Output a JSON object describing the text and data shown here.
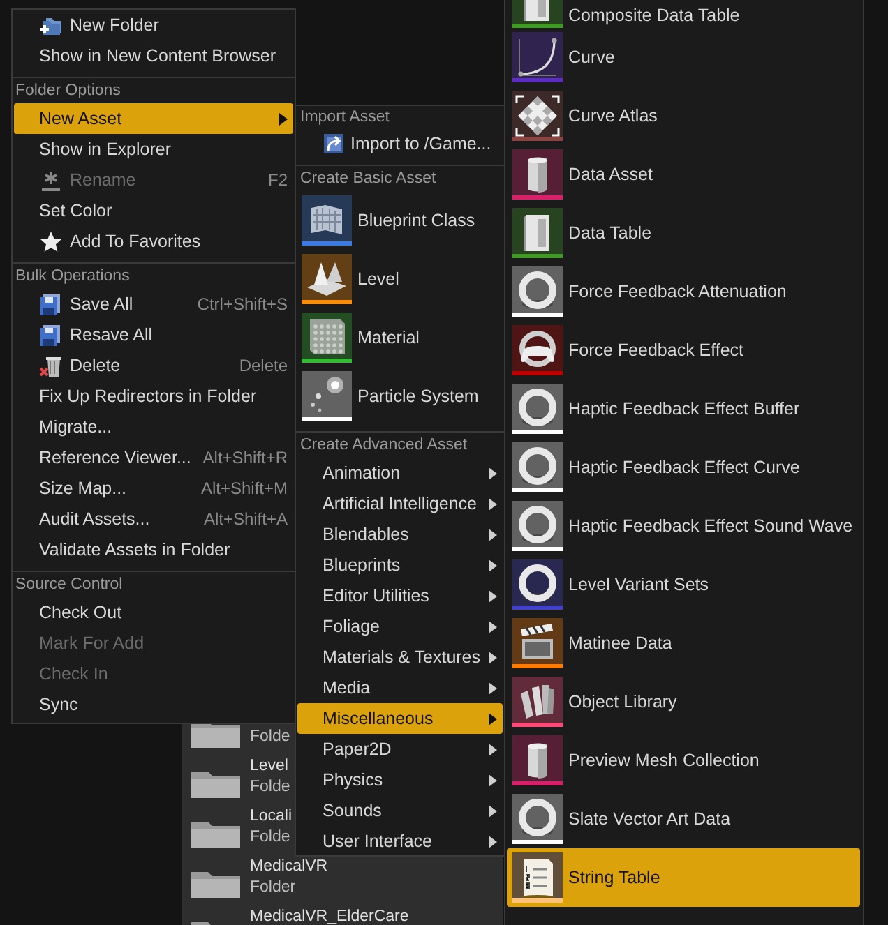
{
  "content_browser": {
    "folders": [
      {
        "type": "Folde"
      },
      {
        "name": "Level",
        "type": "Folde"
      },
      {
        "name": "Locali",
        "type": "Folde"
      },
      {
        "name": "MedicalVR",
        "type": "Folder"
      },
      {
        "name": "MedicalVR_ElderCare"
      }
    ]
  },
  "folder_menu": {
    "sections": [
      {
        "items": [
          {
            "label": "New Folder",
            "kind": "new-folder",
            "selected": false,
            "disabled": false,
            "submenu": false
          },
          {
            "label": "Show in New Content Browser",
            "selected": false,
            "disabled": false,
            "submenu": false
          }
        ]
      },
      {
        "header": "Folder Options",
        "items": [
          {
            "label": "New Asset",
            "selected": true,
            "disabled": false,
            "submenu": true
          },
          {
            "label": "Show in Explorer",
            "selected": false,
            "disabled": false,
            "submenu": false
          },
          {
            "label": "Rename",
            "kind": "rename",
            "shortcut": "F2",
            "selected": false,
            "disabled": true,
            "submenu": false
          },
          {
            "label": "Set Color",
            "selected": false,
            "disabled": false,
            "submenu": false
          },
          {
            "label": "Add To Favorites",
            "kind": "star",
            "selected": false,
            "disabled": false,
            "submenu": false
          }
        ]
      },
      {
        "header": "Bulk Operations",
        "items": [
          {
            "label": "Save All",
            "kind": "save",
            "shortcut": "Ctrl+Shift+S",
            "selected": false,
            "disabled": false,
            "submenu": false
          },
          {
            "label": "Resave All",
            "kind": "save",
            "selected": false,
            "disabled": false,
            "submenu": false
          },
          {
            "label": "Delete",
            "kind": "delete",
            "shortcut": "Delete",
            "selected": false,
            "disabled": false,
            "submenu": false
          },
          {
            "label": "Fix Up Redirectors in Folder",
            "selected": false,
            "disabled": false,
            "submenu": false
          },
          {
            "label": "Migrate...",
            "selected": false,
            "disabled": false,
            "submenu": false
          },
          {
            "label": "Reference Viewer...",
            "shortcut": "Alt+Shift+R",
            "selected": false,
            "disabled": false,
            "submenu": false
          },
          {
            "label": "Size Map...",
            "shortcut": "Alt+Shift+M",
            "selected": false,
            "disabled": false,
            "submenu": false
          },
          {
            "label": "Audit Assets...",
            "shortcut": "Alt+Shift+A",
            "selected": false,
            "disabled": false,
            "submenu": false
          },
          {
            "label": "Validate Assets in Folder",
            "selected": false,
            "disabled": false,
            "submenu": false
          }
        ]
      },
      {
        "header": "Source Control",
        "items": [
          {
            "label": "Check Out",
            "selected": false,
            "disabled": false,
            "submenu": false
          },
          {
            "label": "Mark For Add",
            "selected": false,
            "disabled": true,
            "submenu": false
          },
          {
            "label": "Check In",
            "selected": false,
            "disabled": true,
            "submenu": false
          },
          {
            "label": "Sync",
            "selected": false,
            "disabled": false,
            "submenu": false
          }
        ]
      }
    ]
  },
  "new_asset_menu": {
    "import_header": "Import Asset",
    "import_item": {
      "label": "Import to /Game..."
    },
    "basic_header": "Create Basic Asset",
    "basic_items": [
      {
        "label": "Blueprint Class",
        "kind": "blueprint",
        "color": "#3a7ae0"
      },
      {
        "label": "Level",
        "kind": "level",
        "color": "#ff8c00"
      },
      {
        "label": "Material",
        "kind": "material",
        "color": "#33bb33"
      },
      {
        "label": "Particle System",
        "kind": "particle",
        "color": "#ffffff"
      }
    ],
    "advanced_header": "Create Advanced Asset",
    "advanced_items": [
      {
        "label": "Animation",
        "selected": false,
        "submenu": true
      },
      {
        "label": "Artificial Intelligence",
        "selected": false,
        "submenu": true
      },
      {
        "label": "Blendables",
        "selected": false,
        "submenu": true
      },
      {
        "label": "Blueprints",
        "selected": false,
        "submenu": true
      },
      {
        "label": "Editor Utilities",
        "selected": false,
        "submenu": true
      },
      {
        "label": "Foliage",
        "selected": false,
        "submenu": true
      },
      {
        "label": "Materials & Textures",
        "selected": false,
        "submenu": true
      },
      {
        "label": "Media",
        "selected": false,
        "submenu": true
      },
      {
        "label": "Miscellaneous",
        "selected": true,
        "submenu": true
      },
      {
        "label": "Paper2D",
        "selected": false,
        "submenu": true
      },
      {
        "label": "Physics",
        "selected": false,
        "submenu": true
      },
      {
        "label": "Sounds",
        "selected": false,
        "submenu": true
      },
      {
        "label": "User Interface",
        "selected": false,
        "submenu": true
      }
    ]
  },
  "miscellaneous_menu": {
    "items": [
      {
        "label": "Composite Data Table",
        "kind": "table",
        "color": "#3f9a24",
        "selected": false
      },
      {
        "label": "Curve",
        "kind": "curve",
        "color": "#5a2ec0",
        "selected": false
      },
      {
        "label": "Curve Atlas",
        "kind": "checker",
        "color": "#8a4444",
        "selected": false
      },
      {
        "label": "Data Asset",
        "kind": "cylinder",
        "color": "#d8206a",
        "selected": false
      },
      {
        "label": "Data Table",
        "kind": "table",
        "color": "#3f9a24",
        "selected": false
      },
      {
        "label": "Force Feedback Attenuation",
        "kind": "ring",
        "color": "#ffffff",
        "selected": false
      },
      {
        "label": "Force Feedback Effect",
        "kind": "gamepad",
        "color": "#c00000",
        "selected": false
      },
      {
        "label": "Haptic Feedback Effect Buffer",
        "kind": "ring",
        "color": "#ffffff",
        "selected": false
      },
      {
        "label": "Haptic Feedback Effect Curve",
        "kind": "ring",
        "color": "#ffffff",
        "selected": false
      },
      {
        "label": "Haptic Feedback Effect Sound Wave",
        "kind": "ring",
        "color": "#ffffff",
        "selected": false
      },
      {
        "label": "Level Variant Sets",
        "kind": "ring",
        "color": "#4040c8",
        "selected": false
      },
      {
        "label": "Matinee Data",
        "kind": "clapper",
        "color": "#ff7a00",
        "selected": false
      },
      {
        "label": "Object Library",
        "kind": "books",
        "color": "#ff4a78",
        "selected": false
      },
      {
        "label": "Preview Mesh Collection",
        "kind": "cylinder",
        "color": "#d8206a",
        "selected": false
      },
      {
        "label": "Slate Vector Art Data",
        "kind": "ring",
        "color": "#ffffff",
        "selected": false
      },
      {
        "label": "String Table",
        "kind": "document",
        "color": "#ffc27a",
        "selected": true
      }
    ]
  }
}
